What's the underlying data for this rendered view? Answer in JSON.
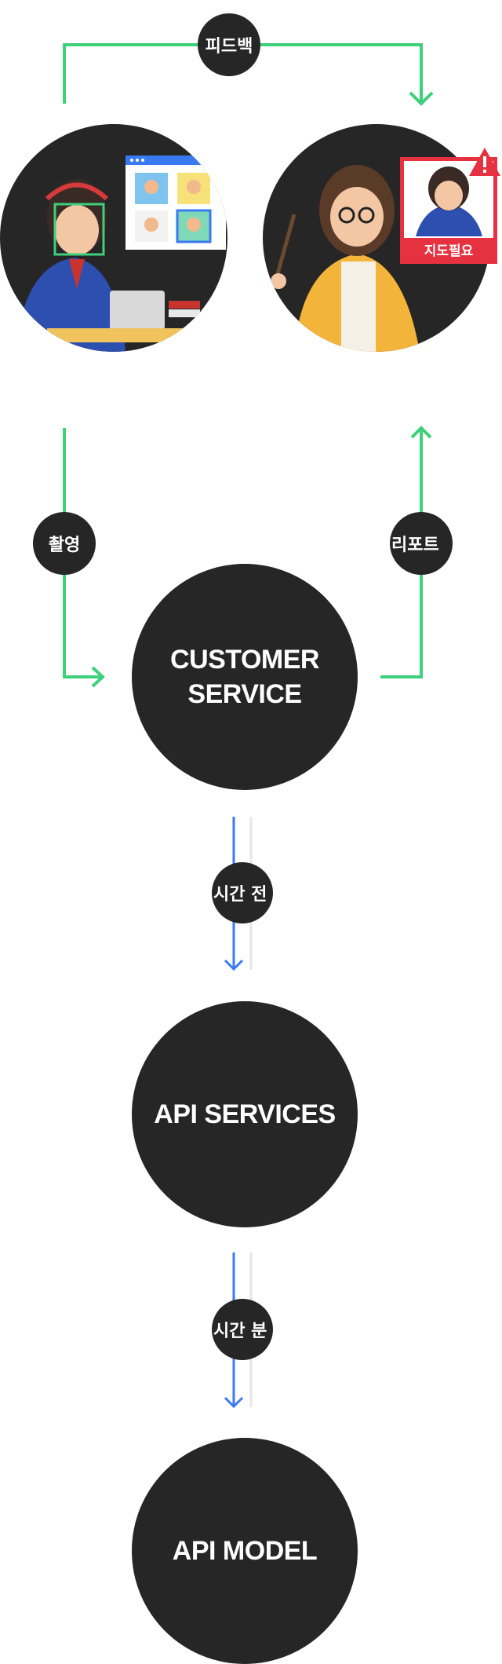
{
  "feedback": {
    "label": "피드백"
  },
  "capture": {
    "label": "촬영"
  },
  "report": {
    "label": "리포트"
  },
  "customer_service": {
    "label": "CUSTOMER\nSERVICE"
  },
  "realtime": {
    "label": "시간 전"
  },
  "api_services": {
    "label": "API SERVICES"
  },
  "analysis": {
    "label": "시간 분"
  },
  "api_model": {
    "label": "API MODEL"
  },
  "teacher": {
    "badge": "지도필요"
  },
  "colors": {
    "green": "#3ed07a",
    "blue": "#3a7af0",
    "circle": "#262626",
    "alert": "#e53140"
  }
}
